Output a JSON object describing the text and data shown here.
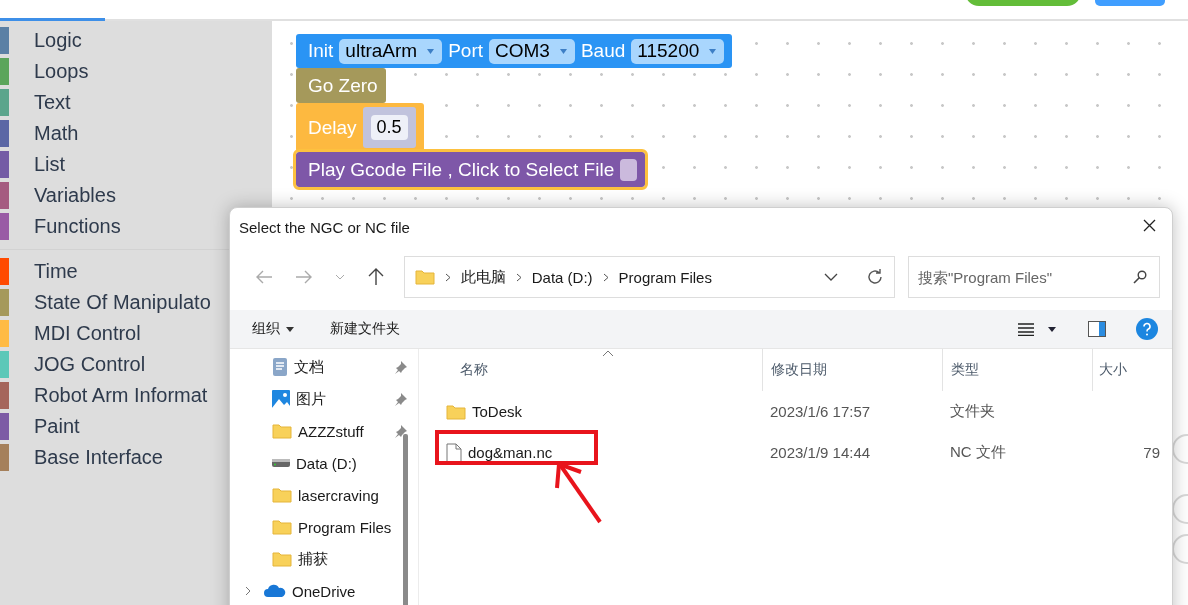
{
  "toolbox": {
    "groups": [
      {
        "categories": [
          {
            "label": "Logic",
            "color": "#5b80a5"
          },
          {
            "label": "Loops",
            "color": "#5ba55b"
          },
          {
            "label": "Text",
            "color": "#5ba58c"
          },
          {
            "label": "Math",
            "color": "#5b67a5"
          },
          {
            "label": "List",
            "color": "#745ba5"
          },
          {
            "label": "Variables",
            "color": "#a55b80"
          },
          {
            "label": "Functions",
            "color": "#995ba5"
          }
        ]
      },
      {
        "categories": [
          {
            "label": "Time",
            "color": "#ff4a00"
          },
          {
            "label": "State Of Manipulato",
            "color": "#a5995b"
          },
          {
            "label": "MDI Control",
            "color": "#ffbb44"
          },
          {
            "label": "JOG Control",
            "color": "#5cc8b8"
          },
          {
            "label": "Robot Arm Informat",
            "color": "#a5655b"
          },
          {
            "label": "Paint",
            "color": "#7d5ba5"
          },
          {
            "label": "Base Interface",
            "color": "#a5805b"
          }
        ]
      }
    ]
  },
  "blocks": [
    {
      "kind": "init",
      "color": "#2a94f4",
      "selected": false,
      "fields": [
        {
          "kind": "label",
          "text": "Init"
        },
        {
          "kind": "dropdown",
          "text": "ultraArm"
        },
        {
          "kind": "label",
          "text": "Port"
        },
        {
          "kind": "dropdown",
          "text": "COM3"
        },
        {
          "kind": "label",
          "text": "Baud"
        },
        {
          "kind": "dropdown",
          "text": "115200"
        }
      ]
    },
    {
      "kind": "statement",
      "color": "#a5995b",
      "selected": false,
      "fields": [
        {
          "kind": "label",
          "text": "Go Zero"
        }
      ]
    },
    {
      "kind": "statement",
      "color": "#fdb940",
      "selected": false,
      "fields": [
        {
          "kind": "label",
          "text": "Delay"
        },
        {
          "kind": "number",
          "text": "0.5"
        }
      ]
    },
    {
      "kind": "statement",
      "color": "#7e57a8",
      "selected": true,
      "fields": [
        {
          "kind": "label",
          "text": "Play Gcode File , Click to Select File"
        },
        {
          "kind": "slot"
        }
      ]
    }
  ],
  "dialog": {
    "title": "Select the NGC or NC file",
    "breadcrumb": [
      "此电脑",
      "Data (D:)",
      "Program Files"
    ],
    "search": {
      "placeholder": "搜索\"Program Files\""
    },
    "toolbar": {
      "organize": "组织",
      "new_folder": "新建文件夹"
    },
    "nav_pane": [
      {
        "label": "文档",
        "kind": "documents",
        "pinned": true
      },
      {
        "label": "图片",
        "kind": "pictures",
        "pinned": true
      },
      {
        "label": "AZZZstuff",
        "kind": "folder",
        "pinned": true
      },
      {
        "label": "Data (D:)",
        "kind": "drive",
        "pinned": false
      },
      {
        "label": "lasercraving",
        "kind": "folder",
        "pinned": false
      },
      {
        "label": "Program Files",
        "kind": "folder",
        "pinned": false
      },
      {
        "label": "捕获",
        "kind": "folder",
        "pinned": false
      },
      {
        "label": "OneDrive",
        "kind": "cloud",
        "pinned": false,
        "expanded": false
      }
    ],
    "columns": [
      "名称",
      "修改日期",
      "类型",
      "大小"
    ],
    "rows": [
      {
        "kind": "folder",
        "name": "ToDesk",
        "modified": "2023/1/6 17:57",
        "type": "文件夹",
        "highlighted": false
      },
      {
        "kind": "file",
        "name": "dog&man.nc",
        "modified": "2023/1/9 14:44",
        "type": "NC 文件",
        "size": "79",
        "highlighted": true
      }
    ]
  }
}
